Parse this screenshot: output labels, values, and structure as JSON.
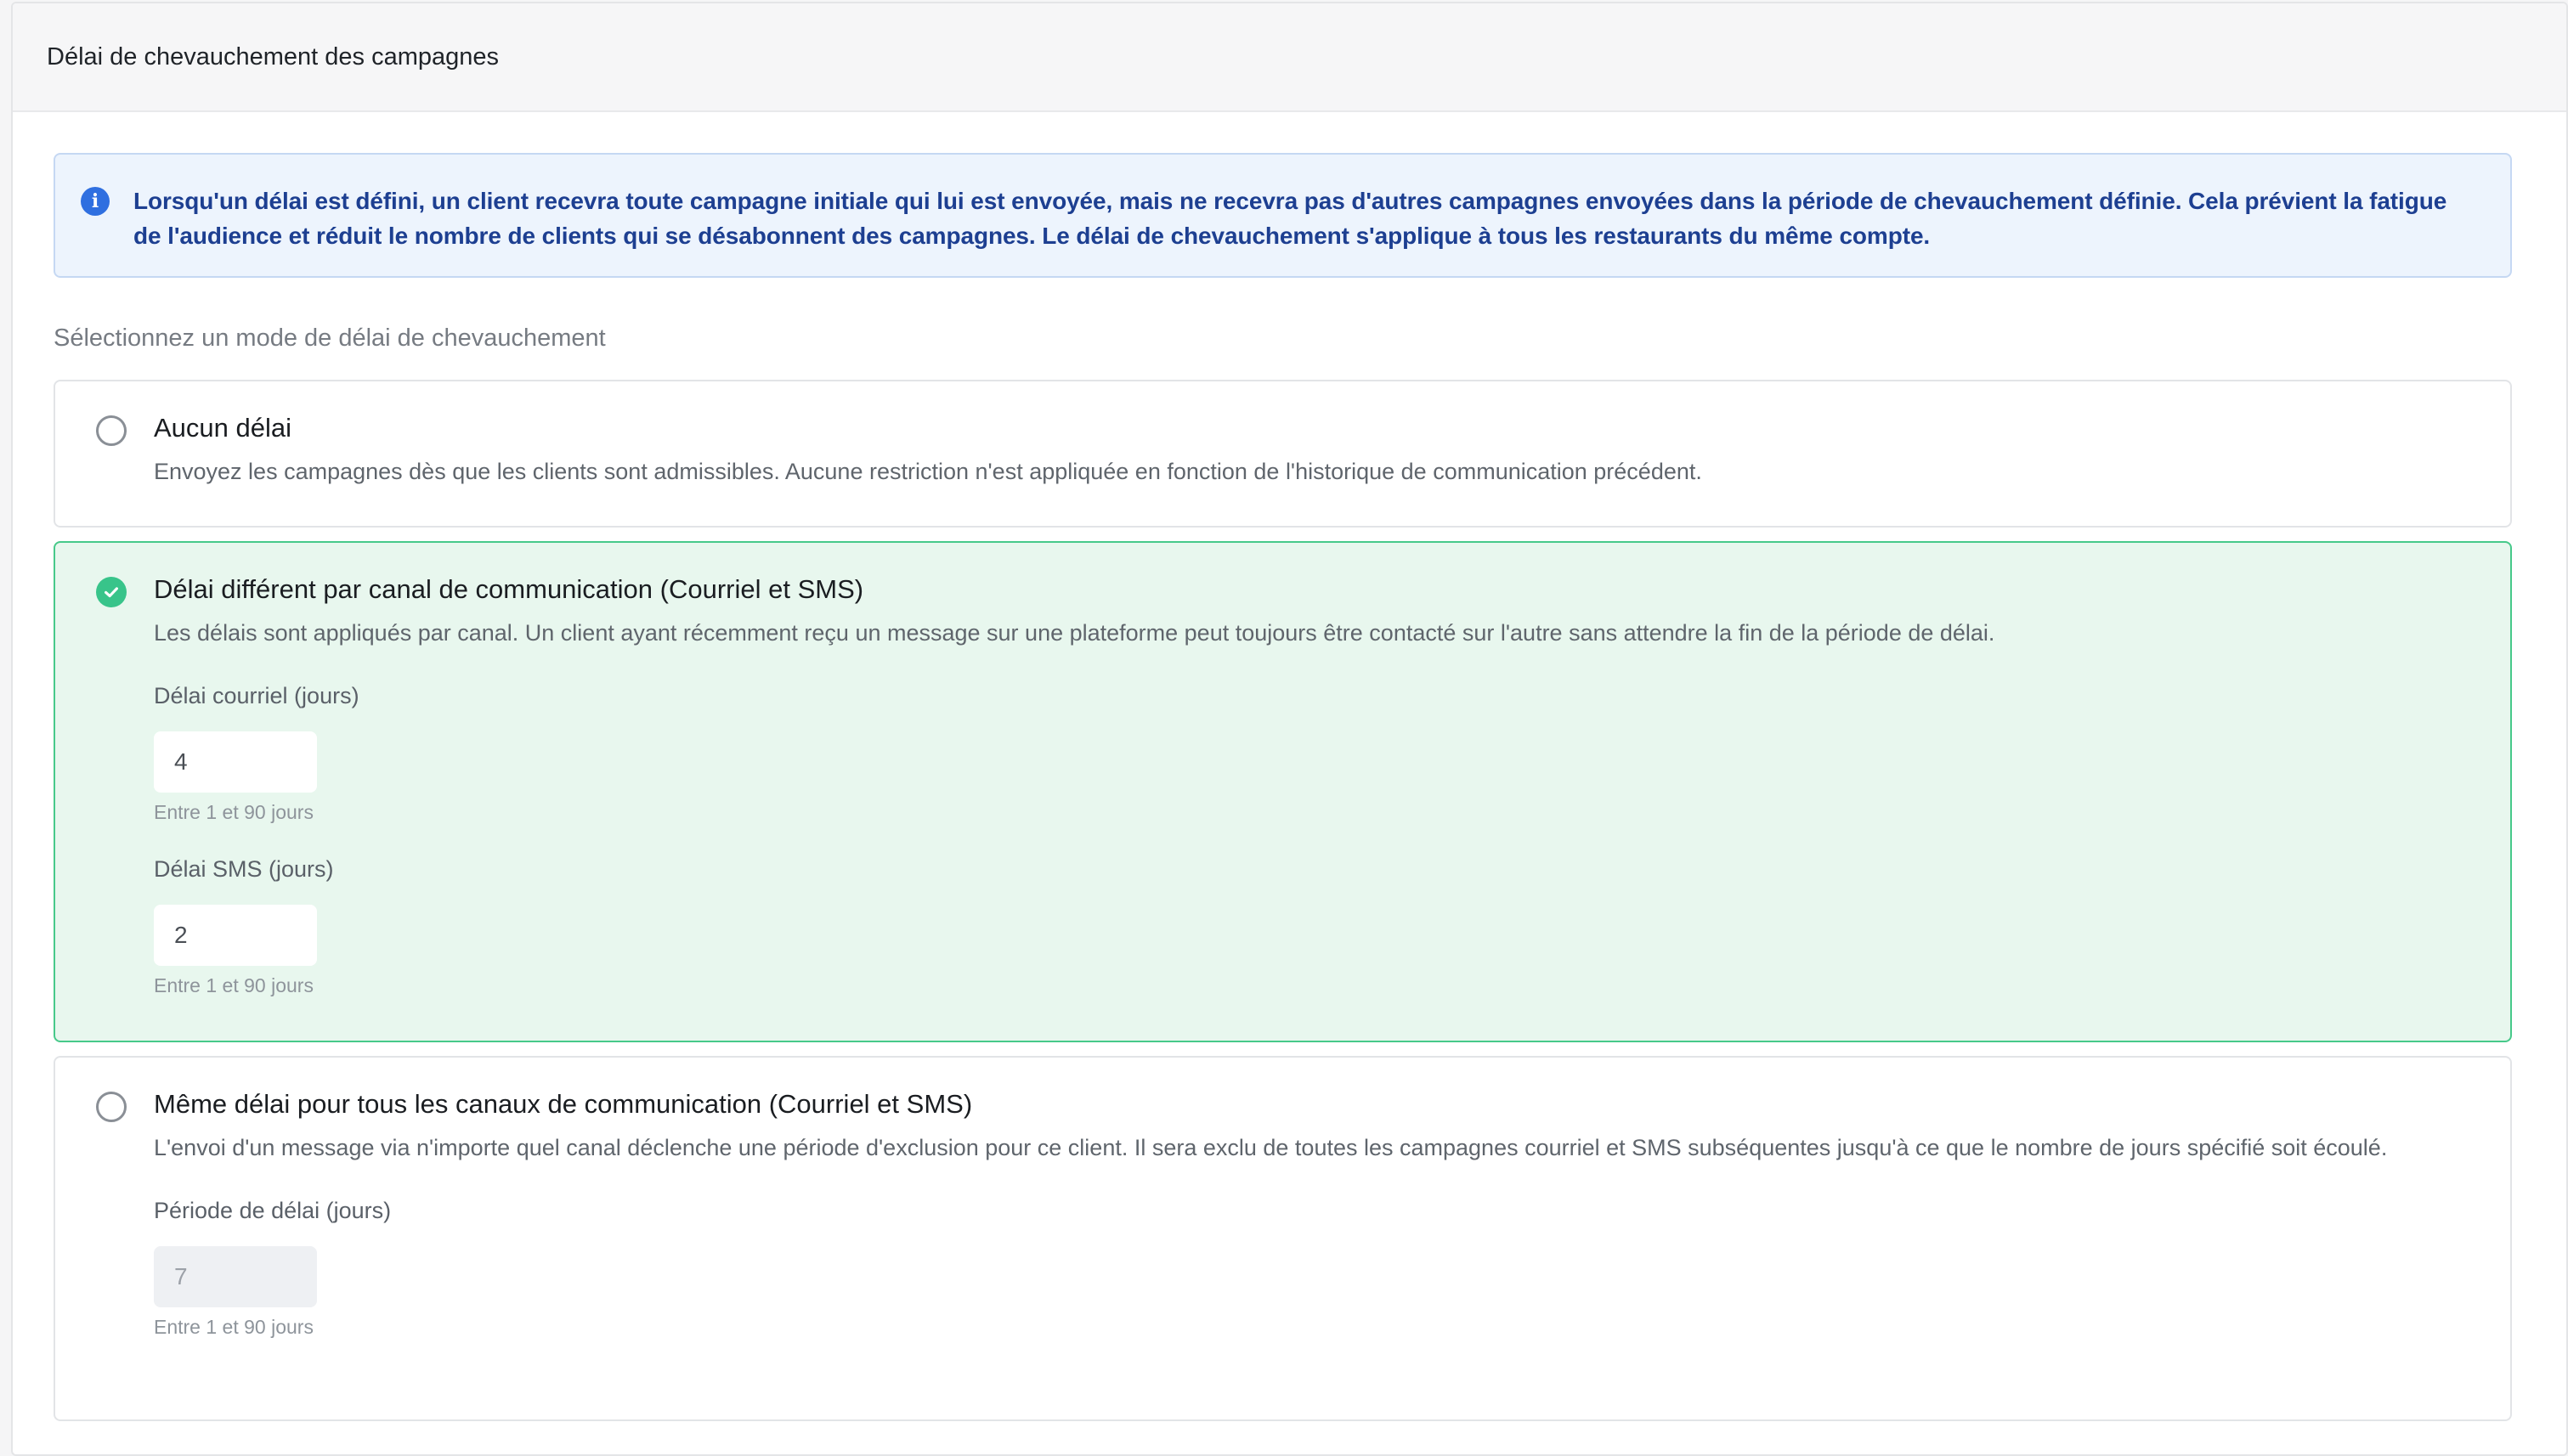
{
  "header": {
    "title": "Délai de chevauchement des campagnes"
  },
  "info": {
    "text": "Lorsqu'un délai est défini, un client recevra toute campagne initiale qui lui est envoyée, mais ne recevra pas d'autres campagnes envoyées dans la période de chevauchement définie. Cela prévient la fatigue de l'audience et réduit le nombre de clients qui se désabonnent des campagnes. Le délai de chevauchement s'applique à tous les restaurants du même compte.",
    "icon": "info-icon"
  },
  "section_label": "Sélectionnez un mode de délai de chevauchement",
  "options": [
    {
      "title": "Aucun délai",
      "description": "Envoyez les campagnes dès que les clients sont admissibles. Aucune restriction n'est appliquée en fonction de l'historique de communication précédent.",
      "selected": false
    },
    {
      "title": "Délai différent par canal de communication (Courriel et SMS)",
      "description": "Les délais sont appliqués par canal. Un client ayant récemment reçu un message sur une plateforme peut toujours être contacté sur l'autre sans attendre la fin de la période de délai.",
      "selected": true,
      "fields": [
        {
          "label": "Délai courriel (jours)",
          "value": "4",
          "hint": "Entre 1 et 90 jours"
        },
        {
          "label": "Délai SMS (jours)",
          "value": "2",
          "hint": "Entre 1 et 90 jours"
        }
      ]
    },
    {
      "title": "Même délai pour tous les canaux de communication (Courriel et SMS)",
      "description": "L'envoi d'un message via n'importe quel canal déclenche une période d'exclusion pour ce client. Il sera exclu de toutes les campagnes courriel et SMS subséquentes jusqu'à ce que le nombre de jours spécifié soit écoulé.",
      "selected": false,
      "fields": [
        {
          "label": "Période de délai (jours)",
          "value": "7",
          "hint": "Entre 1 et 90 jours",
          "disabled": true
        }
      ]
    }
  ],
  "colors": {
    "selected_bg": "#e8f7ee",
    "selected_border": "#47c98a",
    "check_green": "#38c48a",
    "info_bg": "#edf4fd",
    "info_text": "#1d3f91"
  }
}
